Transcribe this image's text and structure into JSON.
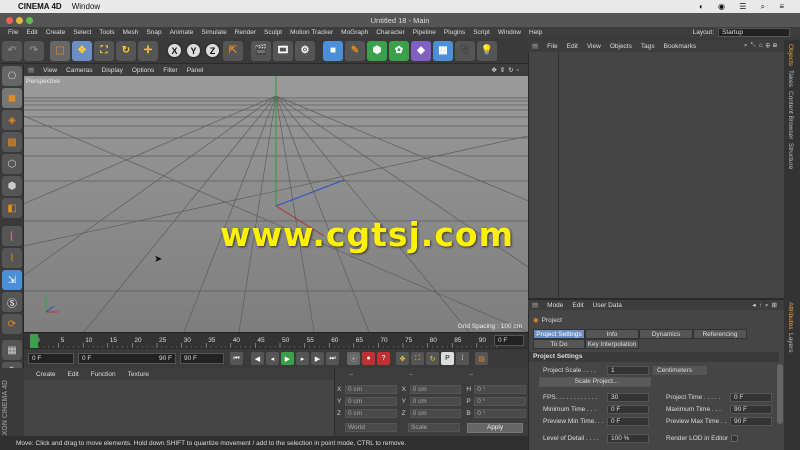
{
  "mac_menu": {
    "app": "CINEMA 4D",
    "window": "Window"
  },
  "window_title": "Untitled 18 - Main",
  "app_menu": [
    "File",
    "Edit",
    "Create",
    "Select",
    "Tools",
    "Mesh",
    "Snap",
    "Animate",
    "Simulate",
    "Render",
    "Sculpt",
    "Motion Tracker",
    "MoGraph",
    "Character",
    "Pipeline",
    "Plugins",
    "Script",
    "Window",
    "Help"
  ],
  "layout": {
    "label": "Layout:",
    "value": "Startup"
  },
  "axis_buttons": [
    "X",
    "Y",
    "Z"
  ],
  "viewport": {
    "menu": [
      "View",
      "Cameras",
      "Display",
      "Options",
      "Filter",
      "Panel"
    ],
    "label": "Perspective",
    "grid_spacing": "Grid Spacing : 100 cm"
  },
  "watermark": "www.cgtsj.com",
  "timeline": {
    "ticks": [
      "0",
      "5",
      "10",
      "15",
      "20",
      "25",
      "30",
      "35",
      "40",
      "45",
      "50",
      "55",
      "60",
      "65",
      "70",
      "75",
      "80",
      "85",
      "90"
    ],
    "end_frame": "0 F"
  },
  "playback": {
    "current": "0 F",
    "start": "0 F",
    "range_end": "90 F",
    "end": "90 F"
  },
  "material_manager": {
    "menu": [
      "Create",
      "Edit",
      "Function",
      "Texture"
    ],
    "logo_top": "MAXON",
    "logo_bottom": "CINEMA 4D"
  },
  "coordinates": {
    "rows": [
      {
        "l1": "X",
        "v1": "0 cm",
        "l2": "X",
        "v2": "0 cm",
        "l3": "H",
        "v3": "0 °"
      },
      {
        "l1": "Y",
        "v1": "0 cm",
        "l2": "Y",
        "v2": "0 cm",
        "l3": "P",
        "v3": "0 °"
      },
      {
        "l1": "Z",
        "v1": "0 cm",
        "l2": "Z",
        "v2": "0 cm",
        "l3": "B",
        "v3": "0 °"
      }
    ],
    "world": "World",
    "scale": "Scale",
    "apply": "Apply",
    "col_headers": [
      "--",
      "--",
      "--"
    ]
  },
  "status": "Move: Click and drag to move elements. Hold down SHIFT to quantize movement / add to the selection in point mode, CTRL to remove.",
  "object_manager": {
    "menu": [
      "File",
      "Edit",
      "View",
      "Objects",
      "Tags",
      "Bookmarks"
    ]
  },
  "side_tabs": [
    "Objects",
    "Takes",
    "Content Browser",
    "Structure"
  ],
  "side_tabs_bottom": [
    "Attributes",
    "Layers"
  ],
  "attributes": {
    "menu": [
      "Mode",
      "Edit",
      "User Data"
    ],
    "title": "Project",
    "tabs": [
      "Project Settings",
      "Info",
      "Dynamics",
      "Referencing"
    ],
    "tabs2": [
      "To Do",
      "Key Interpolation"
    ],
    "section": "Project Settings",
    "project_scale_label": "Project Scale . . . .",
    "project_scale_value": "1",
    "project_scale_unit": "Centimeters",
    "scale_button": "Scale Project...",
    "left_params": [
      {
        "label": "FPS. . . . . . . . . . . .",
        "value": "30"
      },
      {
        "label": "Minimum Time . . .",
        "value": "0 F"
      },
      {
        "label": "Preview Min Time. . .",
        "value": "0 F"
      },
      {
        "label": "Level of Detail . . . .",
        "value": "100 %"
      }
    ],
    "right_params": [
      {
        "label": "Project Time . . . . .",
        "value": "0 F"
      },
      {
        "label": "Maximum Time . . .",
        "value": "90 F"
      },
      {
        "label": "Preview Max Time . .",
        "value": "90 F"
      },
      {
        "label": "Render LOD in Editor",
        "value": ""
      }
    ]
  }
}
